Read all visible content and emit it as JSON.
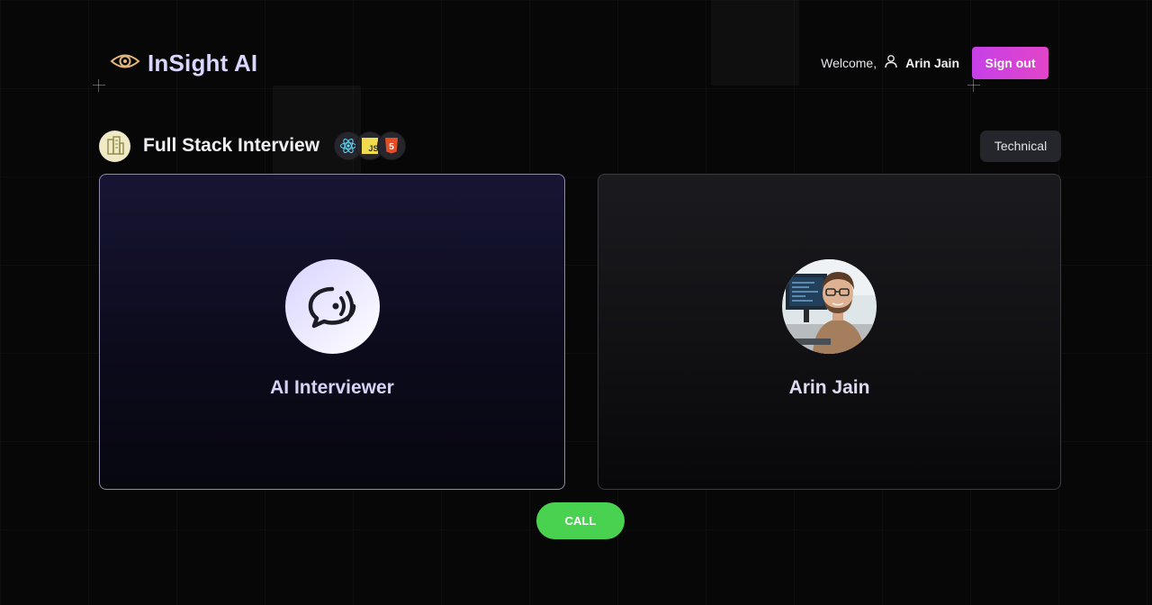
{
  "header": {
    "brand_name": "InSight AI",
    "brand_icon": "eye-logo-icon",
    "welcome_text": "Welcome,",
    "user_icon": "user-icon",
    "username": "Arin Jain",
    "signout_label": "Sign out",
    "signout_color": "#d343dc"
  },
  "interview": {
    "title": "Full Stack Interview",
    "company_logo": "company-logo-icon",
    "tech_stack": [
      "react-icon",
      "javascript-icon",
      "html5-icon"
    ],
    "type": "Technical"
  },
  "cards": {
    "ai": {
      "name": "AI Interviewer",
      "icon": "chat-voice-icon"
    },
    "user": {
      "name": "Arin Jain",
      "avatar": "user-avatar-photo"
    }
  },
  "call": {
    "label": "CALL",
    "color": "#49d24f"
  }
}
